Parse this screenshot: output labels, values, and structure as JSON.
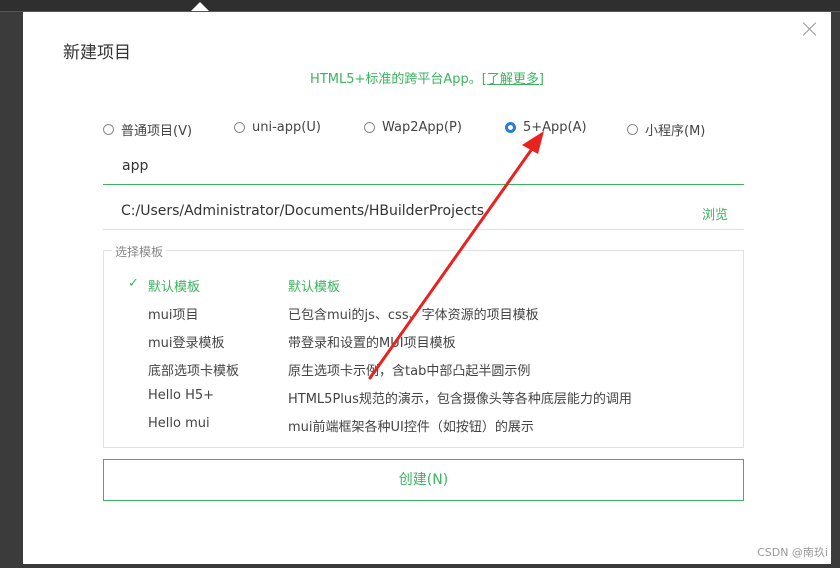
{
  "dialog": {
    "title": "新建项目",
    "subtitle": "HTML5+标准的跨平台App。",
    "learn_more": "[了解更多]",
    "project_types": [
      {
        "label": "普通项目(V)",
        "checked": false
      },
      {
        "label": "uni-app(U)",
        "checked": false
      },
      {
        "label": "Wap2App(P)",
        "checked": false
      },
      {
        "label": "5+App(A)",
        "checked": true
      },
      {
        "label": "小程序(M)",
        "checked": false
      }
    ],
    "project_name": "app",
    "location": "C:/Users/Administrator/Documents/HBuilderProjects",
    "browse_label": "浏览",
    "template_legend": "选择模板",
    "templates": [
      {
        "name": "默认模板",
        "desc": "默认模板",
        "selected": true,
        "check": "✓"
      },
      {
        "name": "mui项目",
        "desc": "已包含mui的js、css、字体资源的项目模板",
        "selected": false
      },
      {
        "name": "mui登录模板",
        "desc": "带登录和设置的MUI项目模板",
        "selected": false
      },
      {
        "name": "底部选项卡模板",
        "desc": "原生选项卡示例，含tab中部凸起半圆示例",
        "selected": false
      },
      {
        "name": "Hello H5+",
        "desc": "HTML5Plus规范的演示，包含摄像头等各种底层能力的调用",
        "selected": false
      },
      {
        "name": "Hello mui",
        "desc": "mui前端框架各种UI控件（如按钮）的展示",
        "selected": false
      }
    ],
    "create_label": "创建(N)"
  },
  "watermark": "CSDN @南玖i",
  "colors": {
    "accent": "#3cb35f",
    "radio_checked": "#2c7bd6",
    "arrow": "#e8231f"
  }
}
